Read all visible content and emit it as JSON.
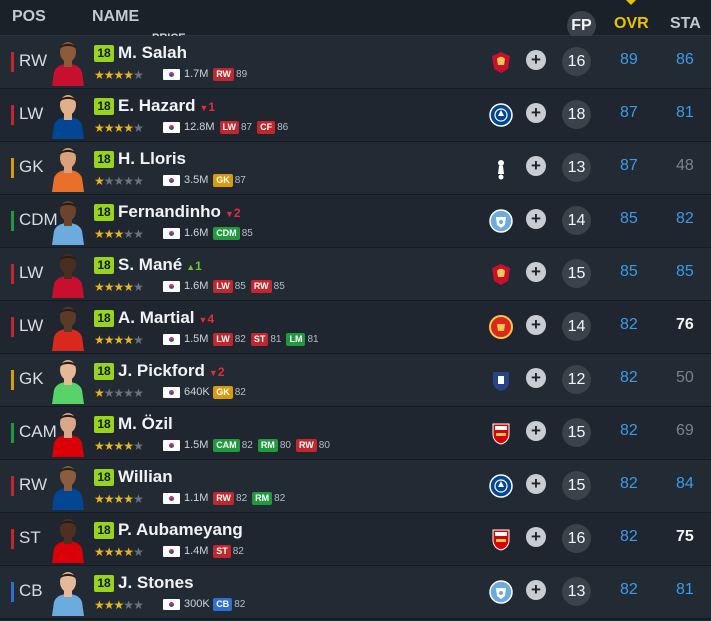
{
  "header": {
    "pos": "POS",
    "name": "NAME",
    "price": "PRICE",
    "fp": "FP",
    "ovr": "OVR",
    "sta": "STA"
  },
  "colors": {
    "fw": "#c1272d",
    "gk": "#d99a0c",
    "mf": "#1f9a3d",
    "df": "#2f6fcf",
    "season_badge": "#97d31f",
    "ovr": "#3d9ae8",
    "header_ovr": "#e8c200"
  },
  "icons": {
    "add": "plus-circle-icon",
    "flag": "south-korea-flag-icon"
  },
  "players": [
    {
      "pos": "RW",
      "pos_group": "fw",
      "season": "18",
      "name": "M. Salah",
      "delta": "",
      "delta_dir": "",
      "stars": 4,
      "price": "1.7M",
      "positions": [
        {
          "pos": "RW",
          "group": "fw",
          "val": "89"
        }
      ],
      "club": "Liverpool",
      "fp": "16",
      "ovr": "89",
      "sta": "86",
      "sta_style": "blue",
      "kit": "#c8102e",
      "skin": "#8d5a3a"
    },
    {
      "pos": "LW",
      "pos_group": "fw",
      "season": "18",
      "name": "E. Hazard",
      "delta": "1",
      "delta_dir": "down",
      "stars": 4,
      "price": "12.8M",
      "positions": [
        {
          "pos": "LW",
          "group": "fw",
          "val": "87"
        },
        {
          "pos": "CF",
          "group": "fw",
          "val": "86"
        }
      ],
      "club": "Chelsea",
      "fp": "18",
      "ovr": "87",
      "sta": "81",
      "sta_style": "blue",
      "kit": "#034694",
      "skin": "#e0b08a"
    },
    {
      "pos": "GK",
      "pos_group": "gk",
      "season": "18",
      "name": "H. Lloris",
      "delta": "",
      "delta_dir": "",
      "stars": 1,
      "price": "3.5M",
      "positions": [
        {
          "pos": "GK",
          "group": "gk",
          "val": "87"
        }
      ],
      "club": "Tottenham",
      "fp": "13",
      "ovr": "87",
      "sta": "48",
      "sta_style": "gray",
      "kit": "#e8702a",
      "skin": "#d9a27c"
    },
    {
      "pos": "CDM",
      "pos_group": "mf",
      "season": "18",
      "name": "Fernandinho",
      "delta": "2",
      "delta_dir": "down",
      "stars": 3,
      "price": "1.6M",
      "positions": [
        {
          "pos": "CDM",
          "group": "mf",
          "val": "85"
        }
      ],
      "club": "Manchester City",
      "fp": "14",
      "ovr": "85",
      "sta": "82",
      "sta_style": "blue",
      "kit": "#6cabdd",
      "skin": "#6b4430"
    },
    {
      "pos": "LW",
      "pos_group": "fw",
      "season": "18",
      "name": "S. Mané",
      "delta": "1",
      "delta_dir": "up",
      "stars": 4,
      "price": "1.6M",
      "positions": [
        {
          "pos": "LW",
          "group": "fw",
          "val": "85"
        },
        {
          "pos": "RW",
          "group": "fw",
          "val": "85"
        }
      ],
      "club": "Liverpool",
      "fp": "15",
      "ovr": "85",
      "sta": "85",
      "sta_style": "blue",
      "kit": "#c8102e",
      "skin": "#4a2e22"
    },
    {
      "pos": "LW",
      "pos_group": "fw",
      "season": "18",
      "name": "A. Martial",
      "delta": "4",
      "delta_dir": "down",
      "stars": 4,
      "price": "1.5M",
      "positions": [
        {
          "pos": "LW",
          "group": "fw",
          "val": "82"
        },
        {
          "pos": "ST",
          "group": "fw",
          "val": "81"
        },
        {
          "pos": "LM",
          "group": "mf",
          "val": "81"
        }
      ],
      "club": "Manchester United",
      "fp": "14",
      "ovr": "82",
      "sta": "76",
      "sta_style": "white",
      "kit": "#da291c",
      "skin": "#5c3a28"
    },
    {
      "pos": "GK",
      "pos_group": "gk",
      "season": "18",
      "name": "J. Pickford",
      "delta": "2",
      "delta_dir": "down",
      "stars": 1,
      "price": "640K",
      "positions": [
        {
          "pos": "GK",
          "group": "gk",
          "val": "82"
        }
      ],
      "club": "Everton",
      "fp": "12",
      "ovr": "82",
      "sta": "50",
      "sta_style": "gray",
      "kit": "#57d36a",
      "skin": "#e5b896"
    },
    {
      "pos": "CAM",
      "pos_group": "mf",
      "season": "18",
      "name": "M. Özil",
      "delta": "",
      "delta_dir": "",
      "stars": 4,
      "price": "1.5M",
      "positions": [
        {
          "pos": "CAM",
          "group": "mf",
          "val": "82"
        },
        {
          "pos": "RM",
          "group": "mf",
          "val": "80"
        },
        {
          "pos": "RW",
          "group": "fw",
          "val": "80"
        }
      ],
      "club": "Arsenal",
      "fp": "15",
      "ovr": "82",
      "sta": "69",
      "sta_style": "gray",
      "kit": "#db0007",
      "skin": "#d8a888"
    },
    {
      "pos": "RW",
      "pos_group": "fw",
      "season": "18",
      "name": "Willian",
      "delta": "",
      "delta_dir": "",
      "stars": 4,
      "price": "1.1M",
      "positions": [
        {
          "pos": "RW",
          "group": "fw",
          "val": "82"
        },
        {
          "pos": "RM",
          "group": "mf",
          "val": "82"
        }
      ],
      "club": "Chelsea",
      "fp": "15",
      "ovr": "82",
      "sta": "84",
      "sta_style": "blue",
      "kit": "#034694",
      "skin": "#8a5c40"
    },
    {
      "pos": "ST",
      "pos_group": "fw",
      "season": "18",
      "name": "P. Aubameyang",
      "delta": "",
      "delta_dir": "",
      "stars": 4,
      "price": "1.4M",
      "positions": [
        {
          "pos": "ST",
          "group": "fw",
          "val": "82"
        }
      ],
      "club": "Arsenal",
      "fp": "16",
      "ovr": "82",
      "sta": "75",
      "sta_style": "white",
      "kit": "#db0007",
      "skin": "#4d3022"
    },
    {
      "pos": "CB",
      "pos_group": "df",
      "season": "18",
      "name": "J. Stones",
      "delta": "",
      "delta_dir": "",
      "stars": 3,
      "price": "300K",
      "positions": [
        {
          "pos": "CB",
          "group": "df",
          "val": "82"
        }
      ],
      "club": "Manchester City",
      "fp": "13",
      "ovr": "82",
      "sta": "81",
      "sta_style": "blue",
      "kit": "#6cabdd",
      "skin": "#e4b898"
    }
  ]
}
